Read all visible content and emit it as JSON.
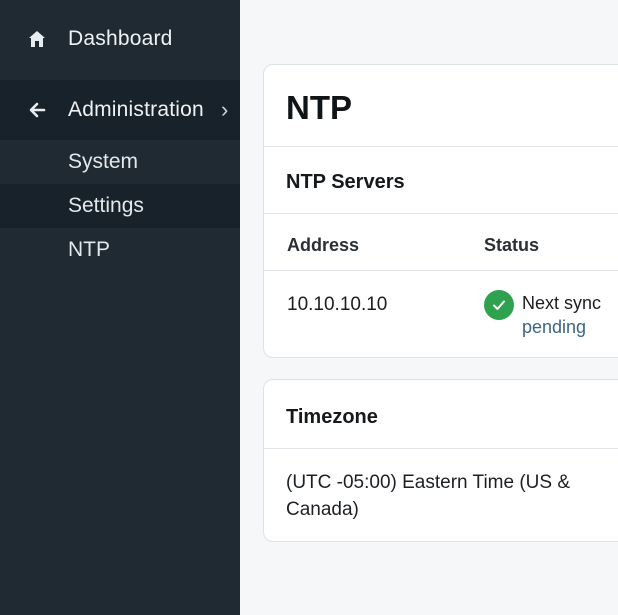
{
  "sidebar": {
    "dashboard_label": "Dashboard",
    "admin_label": "Administration",
    "admin_chevron": "›",
    "sub_items": [
      "System",
      "Settings",
      "NTP"
    ]
  },
  "ntp_card": {
    "title": "NTP",
    "servers_heading": "NTP Servers",
    "columns": [
      "Address",
      "Status"
    ],
    "rows": [
      {
        "address": "10.10.10.10",
        "status": "Next sync",
        "status_detail": "pending"
      }
    ]
  },
  "timezone_card": {
    "heading": "Timezone",
    "value": "(UTC -05:00) Eastern Time (US & Canada)"
  },
  "colors": {
    "sidebar_bg": "#1f2a33",
    "sidebar_active_bg": "#17222a",
    "status_ok": "#2ea24f"
  },
  "icons": [
    "home-icon",
    "back-arrow-icon",
    "check-circle-icon"
  ]
}
